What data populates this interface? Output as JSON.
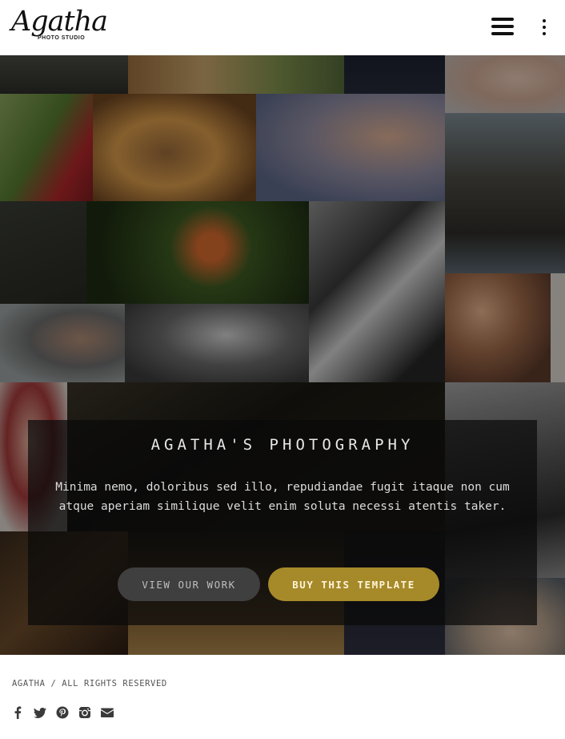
{
  "header": {
    "logo_text": "Agatha",
    "logo_subtitle": "PHOTO STUDIO"
  },
  "hero": {
    "title": "AGATHA'S PHOTOGRAPHY",
    "description": "Minima nemo, doloribus sed illo, repudiandae fugit itaque non cum atque aperiam similique velit enim soluta necessi atentis taker.",
    "buttons": {
      "view_work": "VIEW OUR WORK",
      "buy_template": "BUY THIS TEMPLATE"
    }
  },
  "footer": {
    "copyright": "AGATHA / ALL RIGHTS RESERVED",
    "social": [
      "facebook-icon",
      "twitter-icon",
      "pinterest-icon",
      "instagram-icon",
      "mail-icon"
    ]
  },
  "colors": {
    "accent": "#a68a2a",
    "secondary_button": "#3f3f3f"
  }
}
